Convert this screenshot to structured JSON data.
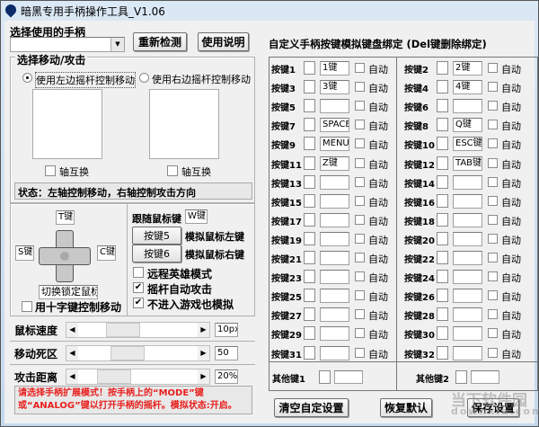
{
  "window": {
    "title": "暗黑专用手柄操作工具_V1.06"
  },
  "left": {
    "select_label": "选择使用的手柄",
    "select_value": "",
    "redetect": "重新检测",
    "help": "使用说明",
    "group_title": "选择移动/攻击",
    "radio_left": "使用左边摇杆控制移动",
    "radio_right": "使用右边摇杆控制移动",
    "radio_selected": "left",
    "axis_swap": "轴互换",
    "status": "状态：左轴控制移动，右轴控制攻击方向",
    "dpad": {
      "up": "T键",
      "left": "S键",
      "right": "C键",
      "lock": "切换锁定鼠标",
      "use_dpad": "用十字键控制移动"
    },
    "follow_label": "跟随鼠标键",
    "follow_value": "W键",
    "key5": "按键5",
    "key5_desc": "模拟鼠标左键",
    "key6": "按键6",
    "key6_desc": "模拟鼠标右键",
    "options": [
      {
        "label": "远程英雄模式",
        "checked": false
      },
      {
        "label": "摇杆自动攻击",
        "checked": true
      },
      {
        "label": "不进入游戏也模拟",
        "checked": true
      }
    ],
    "sliders": [
      {
        "label": "鼠标速度",
        "value": "10px",
        "fraction": 0.3
      },
      {
        "label": "移动死区",
        "value": "50",
        "fraction": 0.35
      },
      {
        "label": "攻击距离",
        "value": "20%",
        "fraction": 0.2
      }
    ],
    "message": "请选择手柄扩展模式！按手柄上的“MODE”键或“ANALOG”键以打开手柄的摇杆。模拟状态:开启。"
  },
  "right": {
    "title": "自定义手柄按键模拟键盘绑定 (Del键删除绑定)",
    "auto_label": "自动",
    "keys": [
      {
        "label": "按键1",
        "value": "1键"
      },
      {
        "label": "按键2",
        "value": "2键"
      },
      {
        "label": "按键3",
        "value": "3键"
      },
      {
        "label": "按键4",
        "value": "4键"
      },
      {
        "label": "按键5",
        "value": ""
      },
      {
        "label": "按键6",
        "value": ""
      },
      {
        "label": "按键7",
        "value": "SPACE"
      },
      {
        "label": "按键8",
        "value": "Q键"
      },
      {
        "label": "按键9",
        "value": "MENU键"
      },
      {
        "label": "按键10",
        "value": "ESC键"
      },
      {
        "label": "按键11",
        "value": "Z键"
      },
      {
        "label": "按键12",
        "value": "TAB键"
      },
      {
        "label": "按键13",
        "value": ""
      },
      {
        "label": "按键14",
        "value": ""
      },
      {
        "label": "按键15",
        "value": ""
      },
      {
        "label": "按键16",
        "value": ""
      },
      {
        "label": "按键17",
        "value": ""
      },
      {
        "label": "按键18",
        "value": ""
      },
      {
        "label": "按键19",
        "value": ""
      },
      {
        "label": "按键20",
        "value": ""
      },
      {
        "label": "按键21",
        "value": ""
      },
      {
        "label": "按键22",
        "value": ""
      },
      {
        "label": "按键23",
        "value": ""
      },
      {
        "label": "按键24",
        "value": ""
      },
      {
        "label": "按键25",
        "value": ""
      },
      {
        "label": "按键26",
        "value": ""
      },
      {
        "label": "按键27",
        "value": ""
      },
      {
        "label": "按键28",
        "value": ""
      },
      {
        "label": "按键29",
        "value": ""
      },
      {
        "label": "按键30",
        "value": ""
      },
      {
        "label": "按键31",
        "value": ""
      },
      {
        "label": "按键32",
        "value": ""
      }
    ],
    "other1": "其他键1",
    "other2": "其他键2",
    "clear": "清空自定设置",
    "restore": "恢复默认",
    "save": "保存设置"
  },
  "watermark": {
    "name": "当下软件园",
    "url": "downxia.com"
  }
}
